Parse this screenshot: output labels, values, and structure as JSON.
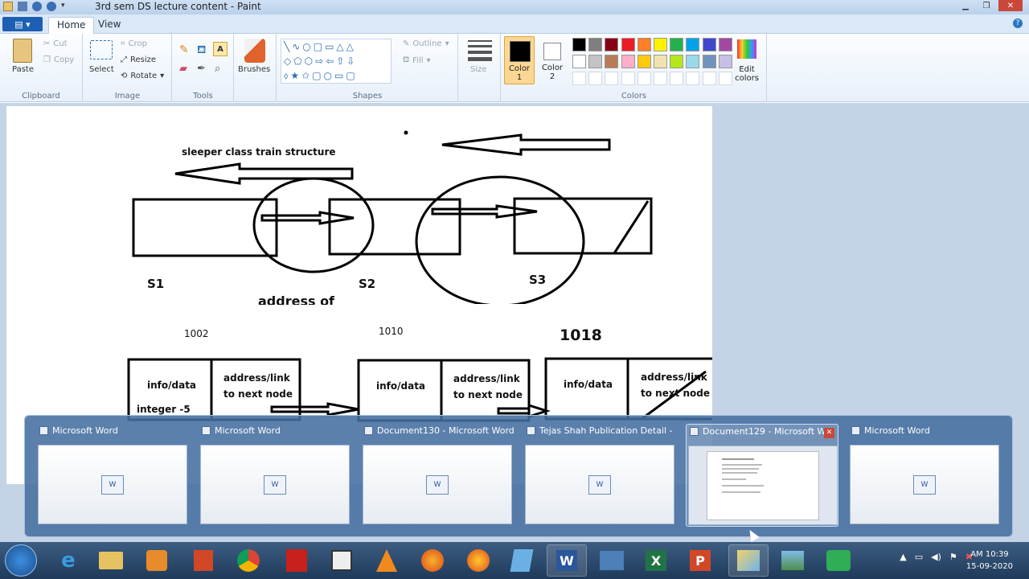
{
  "window": {
    "title": "3rd sem DS lecture content - Paint"
  },
  "ribbon": {
    "tabs": [
      "Home",
      "View"
    ],
    "clipboard": {
      "paste": "Paste",
      "cut": "Cut",
      "copy": "Copy",
      "label": "Clipboard"
    },
    "image": {
      "select": "Select",
      "crop": "Crop",
      "resize": "Resize",
      "rotate": "Rotate",
      "label": "Image"
    },
    "tools": {
      "label": "Tools"
    },
    "brushes": "Brushes",
    "shapes": {
      "outline": "Outline",
      "fill": "Fill",
      "label": "Shapes"
    },
    "size": "Size",
    "color1": "Color\n1",
    "color2": "Color\n2",
    "edit_colors": "Edit colors",
    "colors_label": "Colors",
    "palette_row1": [
      "#000000",
      "#7f7f7f",
      "#880015",
      "#ed1c24",
      "#ff7f27",
      "#fff200",
      "#22b14c",
      "#00a2e8",
      "#3f48cc",
      "#a349a4"
    ],
    "palette_row2": [
      "#ffffff",
      "#c3c3c3",
      "#b97a57",
      "#ffaec9",
      "#ffc90e",
      "#efe4b0",
      "#b5e61d",
      "#99d9ea",
      "#7092be",
      "#c8bfe7"
    ]
  },
  "canvas": {
    "title_text": "sleeper class train structure",
    "s1": "S1",
    "s2": "S2",
    "s3": "S3",
    "address_of": "address of",
    "addr1": "1002",
    "addr2": "1010",
    "addr3": "1018",
    "info": "info/data",
    "link1": "address/link",
    "link2": "to next node",
    "integer": "integer -5"
  },
  "taskbar_popup": {
    "items": [
      {
        "title": "Microsoft Word"
      },
      {
        "title": "Microsoft Word"
      },
      {
        "title": "Document130 - Microsoft Word"
      },
      {
        "title": "Tejas Shah Publication Detail - ..."
      },
      {
        "title": "Document129 - Microsoft W..."
      },
      {
        "title": "Microsoft Word"
      }
    ]
  },
  "clock": {
    "time": "AM 10:39",
    "date": "15-09-2020"
  }
}
